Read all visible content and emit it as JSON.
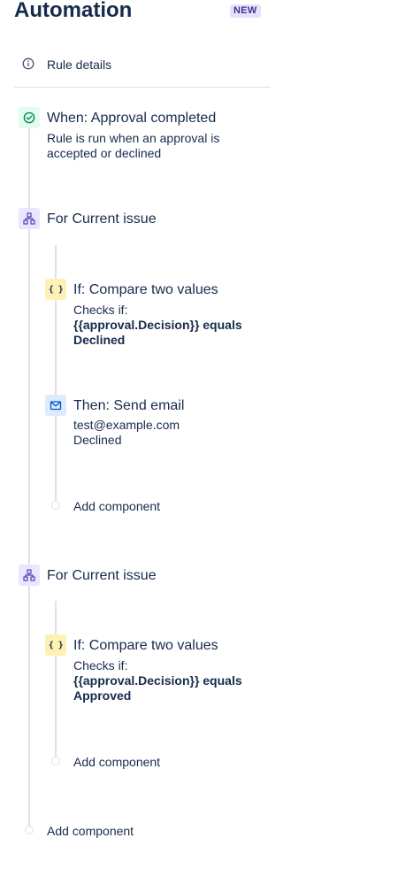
{
  "header": {
    "title": "Automation",
    "badge": "NEW"
  },
  "rule_details": {
    "label": "Rule details",
    "icon": "info-icon"
  },
  "trigger": {
    "title": "When: Approval completed",
    "description_line1": "Rule is run when an approval is",
    "description_line2": "accepted or declined",
    "icon": "check-circle-icon"
  },
  "branches": [
    {
      "title": "For Current issue",
      "icon": "hierarchy-icon",
      "condition": {
        "title": "If: Compare two values",
        "checks_label": "Checks if:",
        "expression_line1": "{{approval.Decision}} equals",
        "expression_line2": "Declined",
        "icon": "braces-icon"
      },
      "action": {
        "title": "Then: Send email",
        "line1": "test@example.com",
        "line2": "Declined",
        "icon": "email-icon"
      },
      "add_component": "Add component"
    },
    {
      "title": "For Current issue",
      "icon": "hierarchy-icon",
      "condition": {
        "title": "If: Compare two values",
        "checks_label": "Checks if:",
        "expression_line1": "{{approval.Decision}} equals",
        "expression_line2": "Approved",
        "icon": "braces-icon"
      },
      "add_component": "Add component"
    }
  ],
  "add_component": "Add component",
  "colors": {
    "text": "#172b4d",
    "badge_bg": "#e6e1fb",
    "badge_text": "#403294",
    "trigger_icon": "#00875a",
    "branch_icon": "#5243aa",
    "condition_bg": "#fff0b3",
    "action_icon": "#0052cc",
    "line": "#dfe1e6"
  }
}
